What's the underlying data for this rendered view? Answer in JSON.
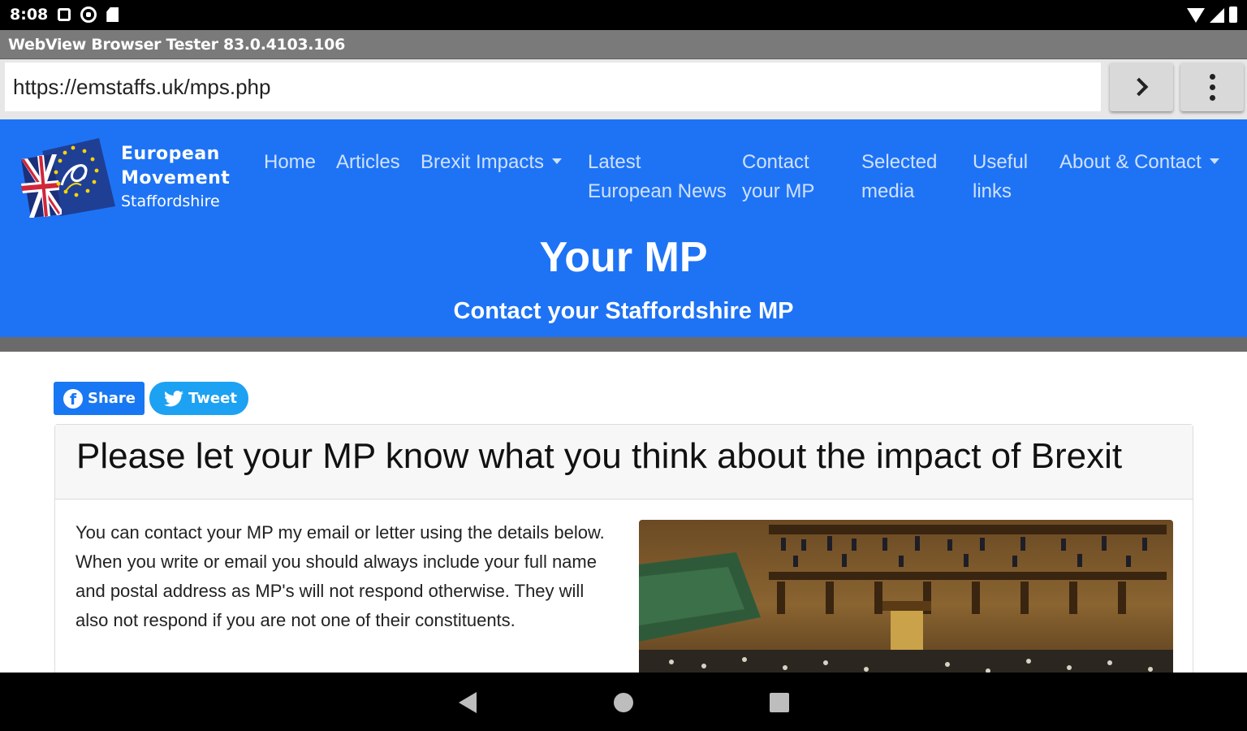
{
  "status_bar": {
    "time": "8:08"
  },
  "app": {
    "title": "WebView Browser Tester 83.0.4103.106"
  },
  "url_bar": {
    "url": "https://emstaffs.uk/mps.php"
  },
  "site": {
    "brand": {
      "line1": "European",
      "line2": "Movement",
      "line3": "Staffordshire"
    },
    "nav": [
      {
        "line1": "Home",
        "line2": ""
      },
      {
        "line1": "Articles",
        "line2": ""
      },
      {
        "line1": "Brexit Impacts",
        "line2": ""
      },
      {
        "line1": "Latest",
        "line2": "European News"
      },
      {
        "line1": "Contact",
        "line2": "your MP"
      },
      {
        "line1": "Selected",
        "line2": "media"
      },
      {
        "line1": "Useful",
        "line2": "links"
      },
      {
        "line1": "About & Contact",
        "line2": ""
      }
    ],
    "hero_title": "Your MP",
    "hero_subtitle": "Contact your Staffordshire MP"
  },
  "social": {
    "share_label": "Share",
    "tweet_label": "Tweet"
  },
  "card": {
    "title": "Please let your MP know what you think about the impact of Brexit",
    "body": "You can contact your MP my email or letter using the details below. When you write or email you should always include your full name and postal address as MP's will not respond otherwise. They will also not respond if you are not one of their constituents."
  },
  "colors": {
    "header_blue": "#1e73f5",
    "nav_link": "#cfe1ff",
    "facebook": "#1877f2",
    "twitter": "#1da1f2"
  }
}
